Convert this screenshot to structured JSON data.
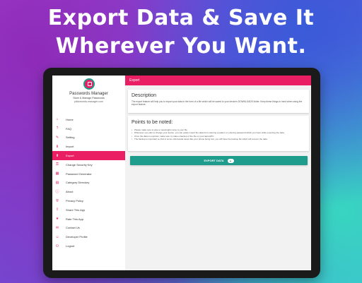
{
  "headline": {
    "line1": "Export Data & Save It",
    "line2": "Wherever You Want."
  },
  "colors": {
    "accent": "#e91e63",
    "button": "#1e9c8c"
  },
  "drawer": {
    "app_name": "Passwords Manager",
    "tagline": "Store & Manage Passwords",
    "website": "pikkowords-manager.com",
    "items": [
      {
        "label": "Home",
        "icon": "home-icon"
      },
      {
        "label": "FAQ",
        "icon": "question-icon"
      },
      {
        "label": "Setting",
        "icon": "wrench-icon"
      },
      {
        "label": "Import",
        "icon": "import-icon"
      },
      {
        "label": "Export",
        "icon": "export-icon"
      },
      {
        "label": "Change Security Key",
        "icon": "key-icon"
      },
      {
        "label": "Password Generator",
        "icon": "generator-icon"
      },
      {
        "label": "Category Directory",
        "icon": "folder-icon"
      },
      {
        "label": "About",
        "icon": "info-icon"
      },
      {
        "label": "Privacy Policy",
        "icon": "shield-icon"
      },
      {
        "label": "Share This App",
        "icon": "share-icon"
      },
      {
        "label": "Rate This App",
        "icon": "star-icon"
      },
      {
        "label": "Contact Us",
        "icon": "mail-icon"
      },
      {
        "label": "Developer Profile",
        "icon": "profile-icon"
      },
      {
        "label": "Logout",
        "icon": "logout-icon"
      }
    ]
  },
  "appbar": {
    "title": "Export"
  },
  "description": {
    "title": "Description",
    "text": "The export feature will help you to export your data in the form of a file which will be saved to your device's DOWNLOADS folder. Keep these things in mind when using the export feature."
  },
  "points": {
    "title": "Points to be noted:",
    "items": [
      "Please make sure to give a meaningful name to your file.",
      "Whenever you plan to change your device, you can easily import the data from entering a pattern or entering password which you have while exporting the data.",
      "Once the data is exported, make sure to make a backup of the file on your laptop/PC.",
      "The backup is important so that in some unfortunate cases like your phone being lost, you will have the backup file which will recover the data."
    ]
  },
  "export_button": {
    "label": "EXPORT DATA"
  }
}
